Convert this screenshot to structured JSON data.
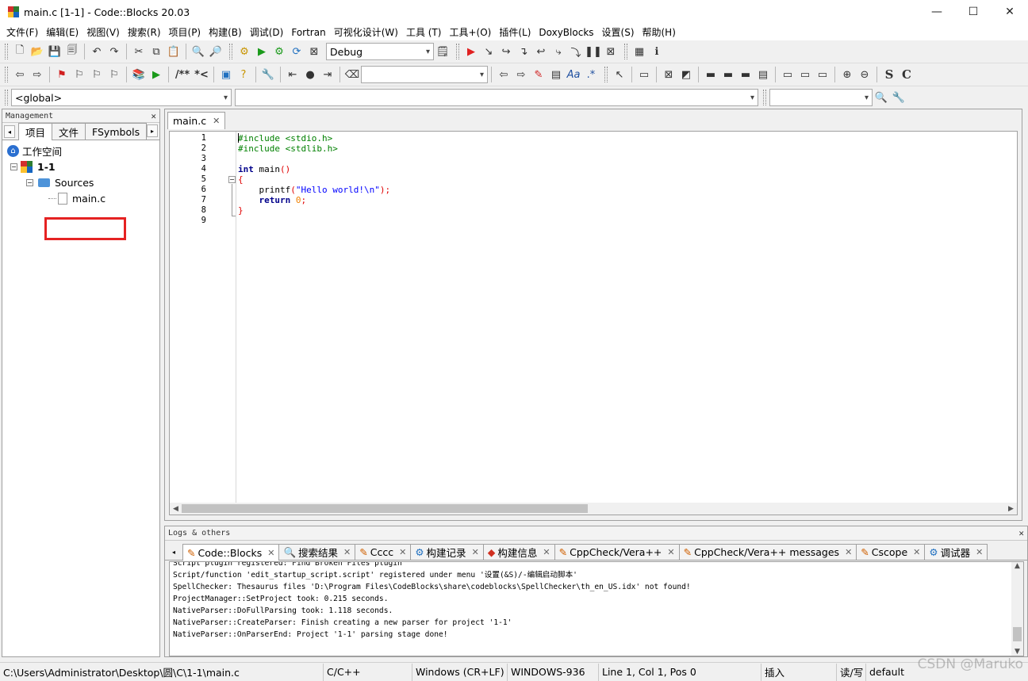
{
  "window": {
    "title": "main.c [1-1] - Code::Blocks 20.03",
    "minimize": "—",
    "maximize": "☐",
    "close": "✕"
  },
  "menu": [
    "文件(F)",
    "编辑(E)",
    "视图(V)",
    "搜索(R)",
    "项目(P)",
    "构建(B)",
    "调试(D)",
    "Fortran",
    "可视化设计(W)",
    "工具 (T)",
    "工具+(O)",
    "插件(L)",
    "DoxyBlocks",
    "设置(S)",
    "帮助(H)"
  ],
  "toolbar": {
    "build_target": "Debug",
    "scope": "<global>",
    "doxy_label": "/**",
    "doxy_label2": "*<",
    "bold_s": "S",
    "bold_c": "C"
  },
  "management": {
    "title": "Management",
    "tabs": [
      "项目",
      "文件",
      "FSymbols"
    ],
    "tree": {
      "workspace": "工作空间",
      "project": "1-1",
      "folder": "Sources",
      "file": "main.c"
    }
  },
  "editor": {
    "tab": "main.c",
    "line_numbers": [
      "1",
      "2",
      "3",
      "4",
      "5",
      "6",
      "7",
      "8",
      "9"
    ],
    "code": {
      "l1": "#include <stdio.h>",
      "l2": "#include <stdlib.h>",
      "l4_kw": "int",
      "l4_rest": " main",
      "l4_paren": "()",
      "l5": "{",
      "l6_fn": "    printf",
      "l6_p1": "(",
      "l6_str": "\"Hello world!\\n\"",
      "l6_p2": ");",
      "l7_kw": "    return",
      "l7_num": " 0",
      "l7_end": ";",
      "l8": "}"
    }
  },
  "logs": {
    "title": "Logs & others",
    "tabs": [
      "Code::Blocks",
      "搜索结果",
      "Cccc",
      "构建记录",
      "构建信息",
      "CppCheck/Vera++",
      "CppCheck/Vera++ messages",
      "Cscope",
      "调试器"
    ],
    "lines": [
      "Script plugin registered: Find Broken Files plugin",
      "Script/function 'edit_startup_script.script' registered under menu '设置(&S)/-编辑启动脚本'",
      "SpellChecker: Thesaurus files 'D:\\Program Files\\CodeBlocks\\share\\codeblocks\\SpellChecker\\th_en_US.idx' not found!",
      "ProjectManager::SetProject took: 0.215 seconds.",
      "NativeParser::DoFullParsing took: 1.118 seconds.",
      "NativeParser::CreateParser: Finish creating a new parser for project '1-1'",
      "NativeParser::OnParserEnd: Project '1-1' parsing stage done!"
    ]
  },
  "status": {
    "path": "C:\\Users\\Administrator\\Desktop\\圆\\C\\1-1\\main.c",
    "language": "C/C++",
    "eol": "Windows (CR+LF)",
    "encoding": "WINDOWS-936",
    "position": "Line 1, Col 1, Pos 0",
    "insert": "插入",
    "rw": "读/写",
    "profile": "default"
  },
  "watermark": "CSDN @Maruko"
}
